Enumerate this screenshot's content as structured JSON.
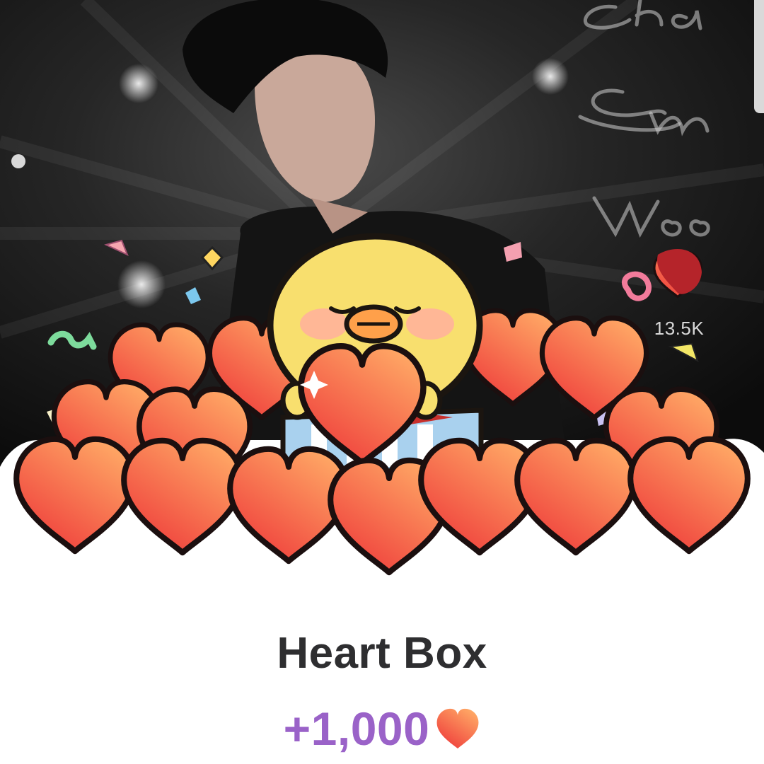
{
  "background": {
    "photo_subject": "portrait-photo",
    "signature_text": "Cha Eun Woo",
    "like_count": "13.5K",
    "colors": {
      "dark": "#111111",
      "mid": "#3a3a3a"
    }
  },
  "reward_card": {
    "title": "Heart Box",
    "amount": "+1,000",
    "currency_icon": "heart-icon"
  },
  "colors": {
    "title_text": "#2e2e30",
    "amount_text": "#9a62c8",
    "heart_light": "#ffa064",
    "heart_dark": "#f0443c",
    "chick_body": "#f8df6e",
    "chick_beak": "#ffa04a"
  },
  "illustration": {
    "character": "yellow-chick",
    "decoration": [
      "confetti",
      "sparkles",
      "heart-pile",
      "gift-box"
    ]
  }
}
